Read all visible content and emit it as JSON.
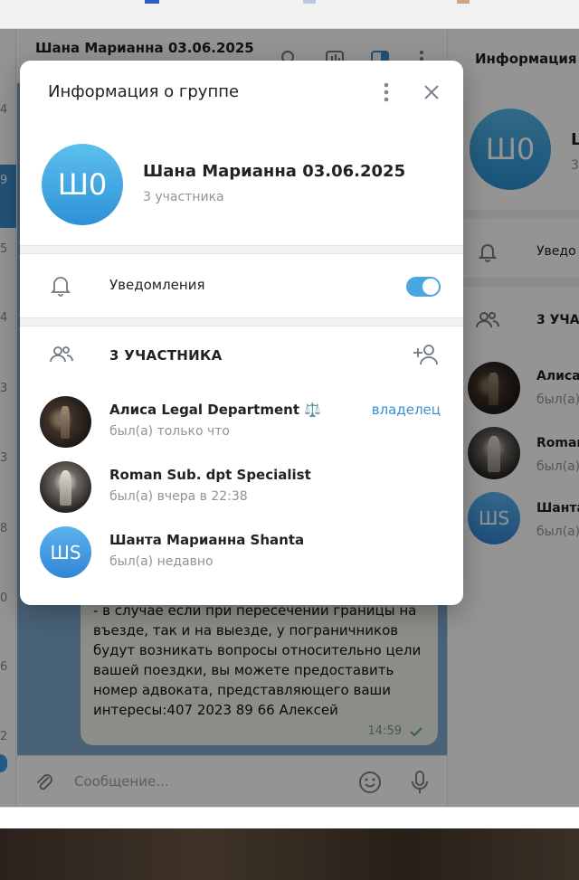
{
  "chat": {
    "title": "Шана Марианна 03.06.2025",
    "message_text": "аэропорта рядом с багажной каруселью.\n- в случае если при пересечении границы на въезде, так и на выезде, у пограничников будут возникать вопросы относительно цели вашей поездки, вы можете предоставить номер адвоката, представляющего ваши интересы:407 2023 89 66 Алексей",
    "message_time": "14:59",
    "composer_placeholder": "Сообщение..."
  },
  "sidebar_numbers": [
    "4",
    "9",
    "5",
    "4",
    "3",
    "3",
    "8",
    "0",
    "6",
    "2"
  ],
  "right_panel": {
    "title": "Информация",
    "avatar_initials": "Ш0",
    "name_fragment": "Ш",
    "sub_fragment": "3",
    "notifications_fragment": "Уведо",
    "members_fragment": "3 УЧАС",
    "members": [
      {
        "name": "Алиса",
        "status": "был(а)"
      },
      {
        "name": "Roman",
        "status": "был(а)"
      },
      {
        "name": "Шанта",
        "status": "был(а)",
        "initials": "ШS"
      }
    ]
  },
  "modal": {
    "title": "Информация о группе",
    "group": {
      "avatar_initials": "Ш0",
      "name": "Шана Марианна 03.06.2025",
      "subtitle": "3 участника"
    },
    "notifications": {
      "label": "Уведомления",
      "enabled": true
    },
    "members_header": "3 УЧАСТНИКА",
    "members": [
      {
        "name": "Алиса Legal Department ⚖️",
        "status": "был(а) только что",
        "role": "владелец"
      },
      {
        "name": "Roman Sub. dpt Specialist",
        "status": "был(а) вчера в 22:38",
        "role": ""
      },
      {
        "name": "Шанта Марианна Shanta",
        "status": "был(а) недавно",
        "role": "",
        "initials": "ШS"
      }
    ]
  },
  "colors": {
    "accent": "#3a8fd2",
    "toggle_on": "#4aa6e2",
    "chat_background": "#7fa9cf",
    "bubble": "#eff5ea"
  }
}
